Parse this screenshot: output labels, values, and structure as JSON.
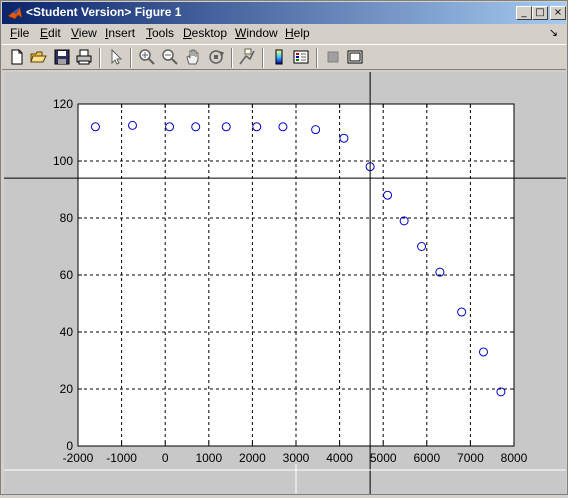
{
  "window": {
    "title": "<Student Version> Figure 1",
    "buttons": {
      "minimize": "_",
      "maximize": "□",
      "close": "×"
    }
  },
  "menu": {
    "items": [
      {
        "label": "File",
        "key": "F",
        "rest": "ile"
      },
      {
        "label": "Edit",
        "key": "E",
        "rest": "dit"
      },
      {
        "label": "View",
        "key": "V",
        "rest": "iew"
      },
      {
        "label": "Insert",
        "key": "I",
        "rest": "nsert"
      },
      {
        "label": "Tools",
        "key": "T",
        "rest": "ools"
      },
      {
        "label": "Desktop",
        "key": "D",
        "rest": "esktop"
      },
      {
        "label": "Window",
        "key": "W",
        "rest": "indow"
      },
      {
        "label": "Help",
        "key": "H",
        "rest": "elp"
      }
    ],
    "dock_arrow": "↘"
  },
  "toolbar": {
    "tools": [
      "new-file-icon",
      "open-folder-icon",
      "save-icon",
      "print-icon",
      "edit-plot-arrow-icon",
      "zoom-in-icon",
      "zoom-out-icon",
      "pan-hand-icon",
      "rotate-3d-icon",
      "data-cursor-icon",
      "colorbar-icon",
      "legend-icon",
      "hide-plot-tools-icon",
      "show-plot-tools-icon"
    ]
  },
  "chart_data": {
    "type": "scatter",
    "marker": "open-circle",
    "marker_color": "#0000cc",
    "grid": true,
    "grid_style": "dashed",
    "xlim": [
      -2000,
      8000
    ],
    "ylim": [
      0,
      120
    ],
    "xticks": [
      -2000,
      -1000,
      0,
      1000,
      2000,
      3000,
      4000,
      5000,
      6000,
      7000,
      8000
    ],
    "yticks": [
      0,
      20,
      40,
      60,
      80,
      100,
      120
    ],
    "xticklabels": [
      "-2000",
      "-1000",
      "0",
      "1000",
      "2000",
      "3000",
      "4000",
      "5000",
      "6000",
      "7000",
      "8000"
    ],
    "yticklabels": [
      "0",
      "20",
      "40",
      "60",
      "80",
      "100",
      "120"
    ],
    "title": "",
    "xlabel": "",
    "ylabel": "",
    "series": [
      {
        "x": [
          -1600,
          -750,
          100,
          700,
          1400,
          2100,
          2700,
          3450,
          4100,
          4700,
          5100,
          5480,
          5880,
          6300,
          6800,
          7300,
          7700
        ],
        "y": [
          112,
          112.5,
          112,
          112,
          112,
          112,
          112,
          111,
          108,
          98,
          88,
          79,
          70,
          61,
          47,
          33,
          19
        ]
      }
    ],
    "crosshair": {
      "x": 4700,
      "y": 94
    }
  }
}
